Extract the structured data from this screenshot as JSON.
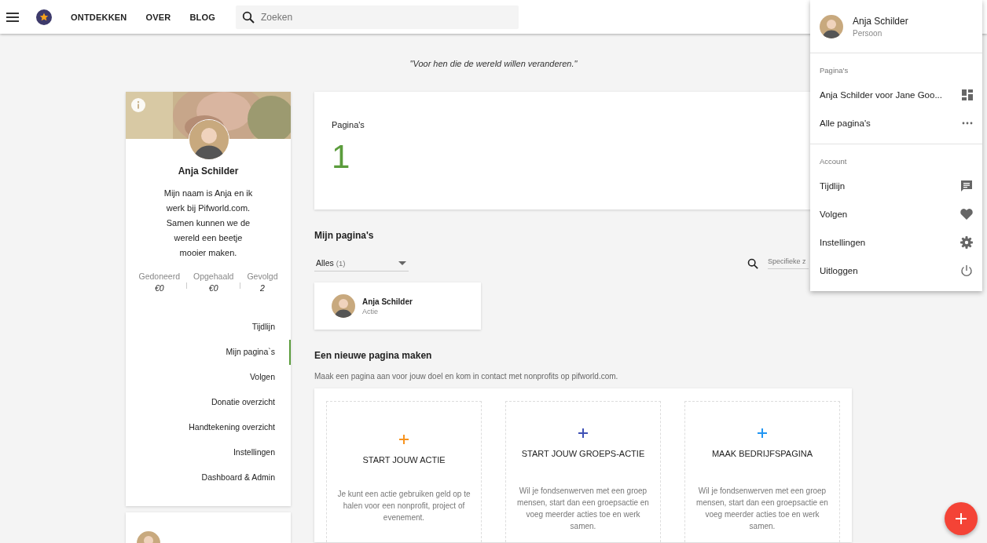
{
  "top_bar": {
    "nav": [
      {
        "label": "ONTDEKKEN"
      },
      {
        "label": "OVER"
      },
      {
        "label": "BLOG"
      }
    ],
    "search": {
      "placeholder": "Zoeken"
    }
  },
  "quote": "\"Voor hen die de wereld willen veranderen.\"",
  "profile": {
    "name": "Anja Schilder",
    "bio": "Mijn naam is Anja en ik werk bij Pifworld.com. Samen kunnen we de wereld een beetje mooier maken.",
    "stats": [
      {
        "label": "Gedoneerd",
        "value": "€0"
      },
      {
        "label": "Opgehaald",
        "value": "€0"
      },
      {
        "label": "Gevolgd",
        "value": "2"
      }
    ],
    "nav": [
      {
        "label": "Tijdlijn",
        "selected": false
      },
      {
        "label": "Mijn pagina`s",
        "selected": true
      },
      {
        "label": "Volgen",
        "selected": false
      },
      {
        "label": "Donatie overzicht",
        "selected": false
      },
      {
        "label": "Handtekening overzicht",
        "selected": false
      },
      {
        "label": "Instellingen",
        "selected": false
      },
      {
        "label": "Dashboard & Admin",
        "selected": false
      }
    ]
  },
  "pages_stat": {
    "label": "Pagina's",
    "value": "1"
  },
  "my_pages": {
    "title": "Mijn pagina's",
    "filter": {
      "value": "Alles",
      "count": "(1)"
    },
    "search": {
      "placeholder": "Specifieke z"
    },
    "cards": [
      {
        "name": "Anja Schilder",
        "type": "Actie"
      }
    ]
  },
  "create": {
    "title": "Een nieuwe pagina maken",
    "intro": "Maak een pagina aan voor jouw doel en kom in contact met nonprofits op pifworld.com.",
    "tiles": [
      {
        "title": "START JOUW ACTIE",
        "color": "#f7931e",
        "text": "Je kunt een actie gebruiken geld op te halen voor een nonprofit, project of evenement."
      },
      {
        "title": "START JOUW GROEPS-ACTIE",
        "color": "#3f51b5",
        "text": "Wil je fondsenwerven met een groep mensen, start dan een groepsactie en voeg meerder acties toe en werk samen."
      },
      {
        "title": "MAAK BEDRIJFSPAGINA",
        "color": "#2196f3",
        "text": "Wil je fondsenwerven met een groep mensen, start dan een groepsactie en voeg meerder acties toe en werk samen."
      }
    ]
  },
  "user_menu": {
    "name": "Anja Schilder",
    "role": "Persoon",
    "sections": [
      {
        "title": "Pagina's",
        "items": [
          {
            "label": "Anja Schilder voor Jane Goo..."
          },
          {
            "label": "Alle pagina's"
          }
        ]
      },
      {
        "title": "Account",
        "items": [
          {
            "label": "Tijdlijn"
          },
          {
            "label": "Volgen"
          },
          {
            "label": "Instellingen"
          },
          {
            "label": "Uitloggen"
          }
        ]
      }
    ]
  }
}
